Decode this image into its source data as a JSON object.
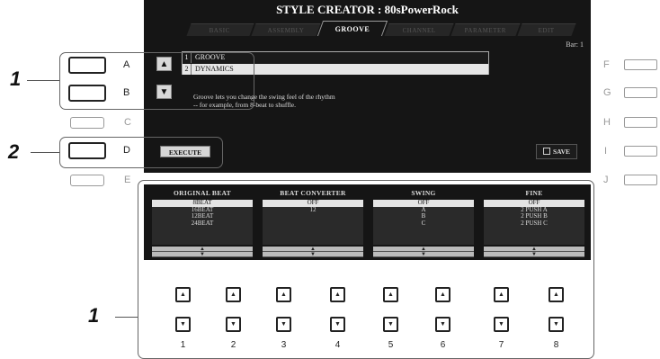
{
  "screen": {
    "title": "STYLE CREATOR : 80sPowerRock",
    "tabs": [
      "BASIC",
      "ASSEMBLY",
      "GROOVE",
      "CHANNEL",
      "PARAMETER",
      "EDIT"
    ],
    "active_tab": "GROOVE",
    "bar_label": "Bar:  1",
    "list_items": [
      {
        "num": "1",
        "label": "GROOVE",
        "selected": false
      },
      {
        "num": "2",
        "label": "DYNAMICS",
        "selected": true
      }
    ],
    "description": "Groove lets you change the swing feel of the rhythm\n-- for example, from 8-beat to shuffle.",
    "execute_label": "EXECUTE",
    "save_label": "SAVE"
  },
  "columns": [
    {
      "header": "ORIGINAL BEAT",
      "items": [
        "8BEAT",
        "16BEAT",
        "12BEAT",
        "24BEAT"
      ],
      "selected": "8BEAT"
    },
    {
      "header": "BEAT CONVERTER",
      "items": [
        "OFF",
        "12"
      ],
      "selected": "OFF"
    },
    {
      "header": "SWING",
      "items": [
        "OFF",
        "A",
        "B",
        "C"
      ],
      "selected": "OFF"
    },
    {
      "header": "FINE",
      "items": [
        "OFF",
        "2 PUSH A",
        "2 PUSH B",
        "2 PUSH C"
      ],
      "selected": "OFF"
    }
  ],
  "left_buttons": [
    "A",
    "B",
    "C",
    "D",
    "E"
  ],
  "right_buttons": [
    "F",
    "G",
    "H",
    "I",
    "J"
  ],
  "bottom_numbers": [
    "1",
    "2",
    "3",
    "4",
    "5",
    "6",
    "7",
    "8"
  ],
  "callouts": [
    "1",
    "2",
    "1"
  ]
}
